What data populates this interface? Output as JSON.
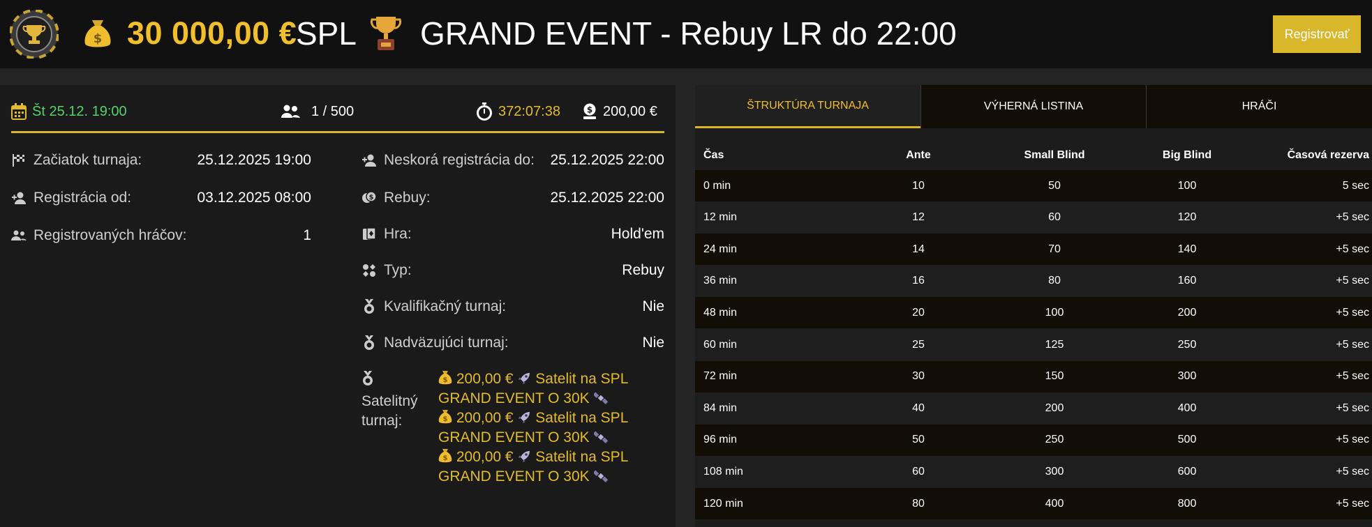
{
  "header": {
    "prize_amount": "30 000,00 €",
    "prize_suffix": "SPL",
    "title": "GRAND EVENT - Rebuy LR do 22:00",
    "register_label": "Registrovať"
  },
  "summary": {
    "date": "Št 25.12. 19:00",
    "players": "1 / 500",
    "timer": "372:07:38",
    "buyin": "200,00 €"
  },
  "details_left": [
    {
      "label": "Začiatok turnaja:",
      "value": "25.12.2025 19:00"
    },
    {
      "label": "Registrácia od:",
      "value": "03.12.2025 08:00"
    },
    {
      "label": "Registrovaných hráčov:",
      "value": "1"
    }
  ],
  "details_right": [
    {
      "label": "Neskorá registrácia do:",
      "value": "25.12.2025 22:00"
    },
    {
      "label": "Rebuy:",
      "value": "25.12.2025 22:00"
    },
    {
      "label": "Hra:",
      "value": "Hold'em"
    },
    {
      "label": "Typ:",
      "value": "Rebuy"
    },
    {
      "label": "Kvalifikačný turnaj:",
      "value": "Nie"
    },
    {
      "label": "Nadväzujúci turnaj:",
      "value": "Nie"
    }
  ],
  "satellite": {
    "label": "Satelitný turnaj:",
    "items": [
      {
        "amount": "200,00 €",
        "name": "Satelit na SPL GRAND EVENT O 30K"
      },
      {
        "amount": "200,00 €",
        "name": "Satelit na SPL GRAND EVENT O 30K"
      },
      {
        "amount": "200,00 €",
        "name": "Satelit na SPL GRAND EVENT O 30K"
      }
    ]
  },
  "tabs": [
    "Štruktúra turnaja",
    "Výherná listina",
    "Hráči"
  ],
  "table": {
    "headers": [
      "Čas",
      "Ante",
      "Small Blind",
      "Big Blind",
      "Časová rezerva"
    ],
    "rows": [
      [
        "0 min",
        "10",
        "50",
        "100",
        "5 sec"
      ],
      [
        "12 min",
        "12",
        "60",
        "120",
        "+5 sec"
      ],
      [
        "24 min",
        "14",
        "70",
        "140",
        "+5 sec"
      ],
      [
        "36 min",
        "16",
        "80",
        "160",
        "+5 sec"
      ],
      [
        "48 min",
        "20",
        "100",
        "200",
        "+5 sec"
      ],
      [
        "60 min",
        "25",
        "125",
        "250",
        "+5 sec"
      ],
      [
        "72 min",
        "30",
        "150",
        "300",
        "+5 sec"
      ],
      [
        "84 min",
        "40",
        "200",
        "400",
        "+5 sec"
      ],
      [
        "96 min",
        "50",
        "250",
        "500",
        "+5 sec"
      ],
      [
        "108 min",
        "60",
        "300",
        "600",
        "+5 sec"
      ],
      [
        "120 min",
        "80",
        "400",
        "800",
        "+5 sec"
      ]
    ]
  },
  "colors": {
    "accent": "#d8b72a",
    "gold_text": "#f1bf2c",
    "date_green": "#54d36a"
  },
  "icons": [
    "chip-logo",
    "money-bag-icon",
    "trophy-icon",
    "calendar-icon",
    "users-icon",
    "stopwatch-icon",
    "coins-icon",
    "flag-icon",
    "user-plus-icon",
    "cards-icon",
    "suits-icon",
    "medal-icon",
    "rocket-icon"
  ]
}
